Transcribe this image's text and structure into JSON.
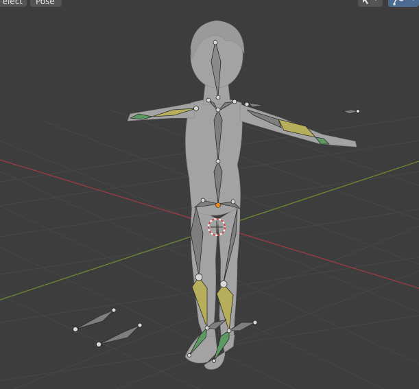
{
  "header": {
    "menu_select_label": "elect",
    "menu_pose_label": "Pose"
  },
  "icons": {
    "cursor_tool": "cursor-arrow-icon",
    "overlay_toggle": "bone-overlay-icon",
    "dropdown": "chevron-down-icon"
  },
  "colors": {
    "background": "#3d3d3d",
    "grid": "#4a4a4a",
    "x_axis": "#9b3c45",
    "y_axis": "#6d8a2f",
    "bone_gray": "#7e7e7e",
    "bone_selected_yellow": "#b6ae5a",
    "bone_green": "#5d9a62",
    "mesh": "#a3a3a3",
    "origin_orange": "#f08a1c",
    "cursor_red": "#d94343",
    "header_button": "#545454",
    "header_button_active": "#4a6a8f"
  }
}
